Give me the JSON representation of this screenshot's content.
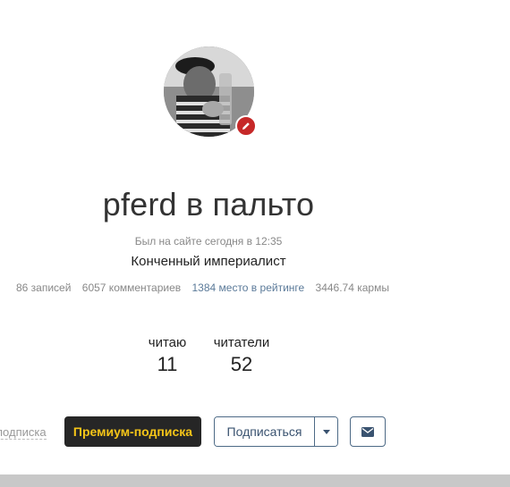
{
  "profile": {
    "name": "pferd в пальто",
    "last_seen": "Был на сайте сегодня в 12:35",
    "status": "Конченный империалист"
  },
  "stats": {
    "posts": "86 записей",
    "comments": "6057 комментариев",
    "rating": "1384 место в рейтинге",
    "karma": "3446.74 кармы"
  },
  "follow": {
    "following_label": "читаю",
    "following_count": "11",
    "followers_label": "читатели",
    "followers_count": "52"
  },
  "actions": {
    "sub_link": "подписка",
    "premium_label": "Премиум-подписка",
    "subscribe_label": "Подписаться"
  },
  "icons": {
    "edit": "pencil-icon",
    "caret": "caret-down-icon",
    "mail": "envelope-icon"
  },
  "colors": {
    "premium_bg": "#262626",
    "premium_text": "#f5c518",
    "accent_border": "#4d6a86",
    "edit_badge": "#c62828",
    "link": "#5b7a99"
  }
}
